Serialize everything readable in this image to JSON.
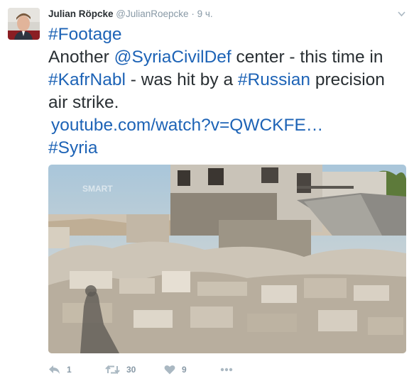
{
  "tweet": {
    "author_name": "Julian Röpcke",
    "handle": "@JulianRoepcke",
    "separator": "·",
    "time": "9 ч.",
    "text": {
      "hashtag1": "#Footage",
      "p1": "Another ",
      "mention": "@SyriaCivilDef",
      "p2": " center - this time in ",
      "hashtag2": "#KafrNabl",
      "p3": " - was hit by a ",
      "hashtag3": "#Russian",
      "p4": " precision air strike.",
      "url": "youtube.com/watch?v=QWCKFE…",
      "hashtag4": "#Syria"
    },
    "media_watermark": "SMART"
  },
  "actions": {
    "reply_count": "1",
    "retweet_count": "30",
    "like_count": "9"
  },
  "icons": {
    "menu": "chevron-down-icon",
    "reply": "reply-icon",
    "retweet": "retweet-icon",
    "like": "heart-icon",
    "more": "more-dots-icon"
  },
  "colors": {
    "link": "#1d63b6",
    "meta": "#8899a6",
    "text": "#292f33"
  }
}
